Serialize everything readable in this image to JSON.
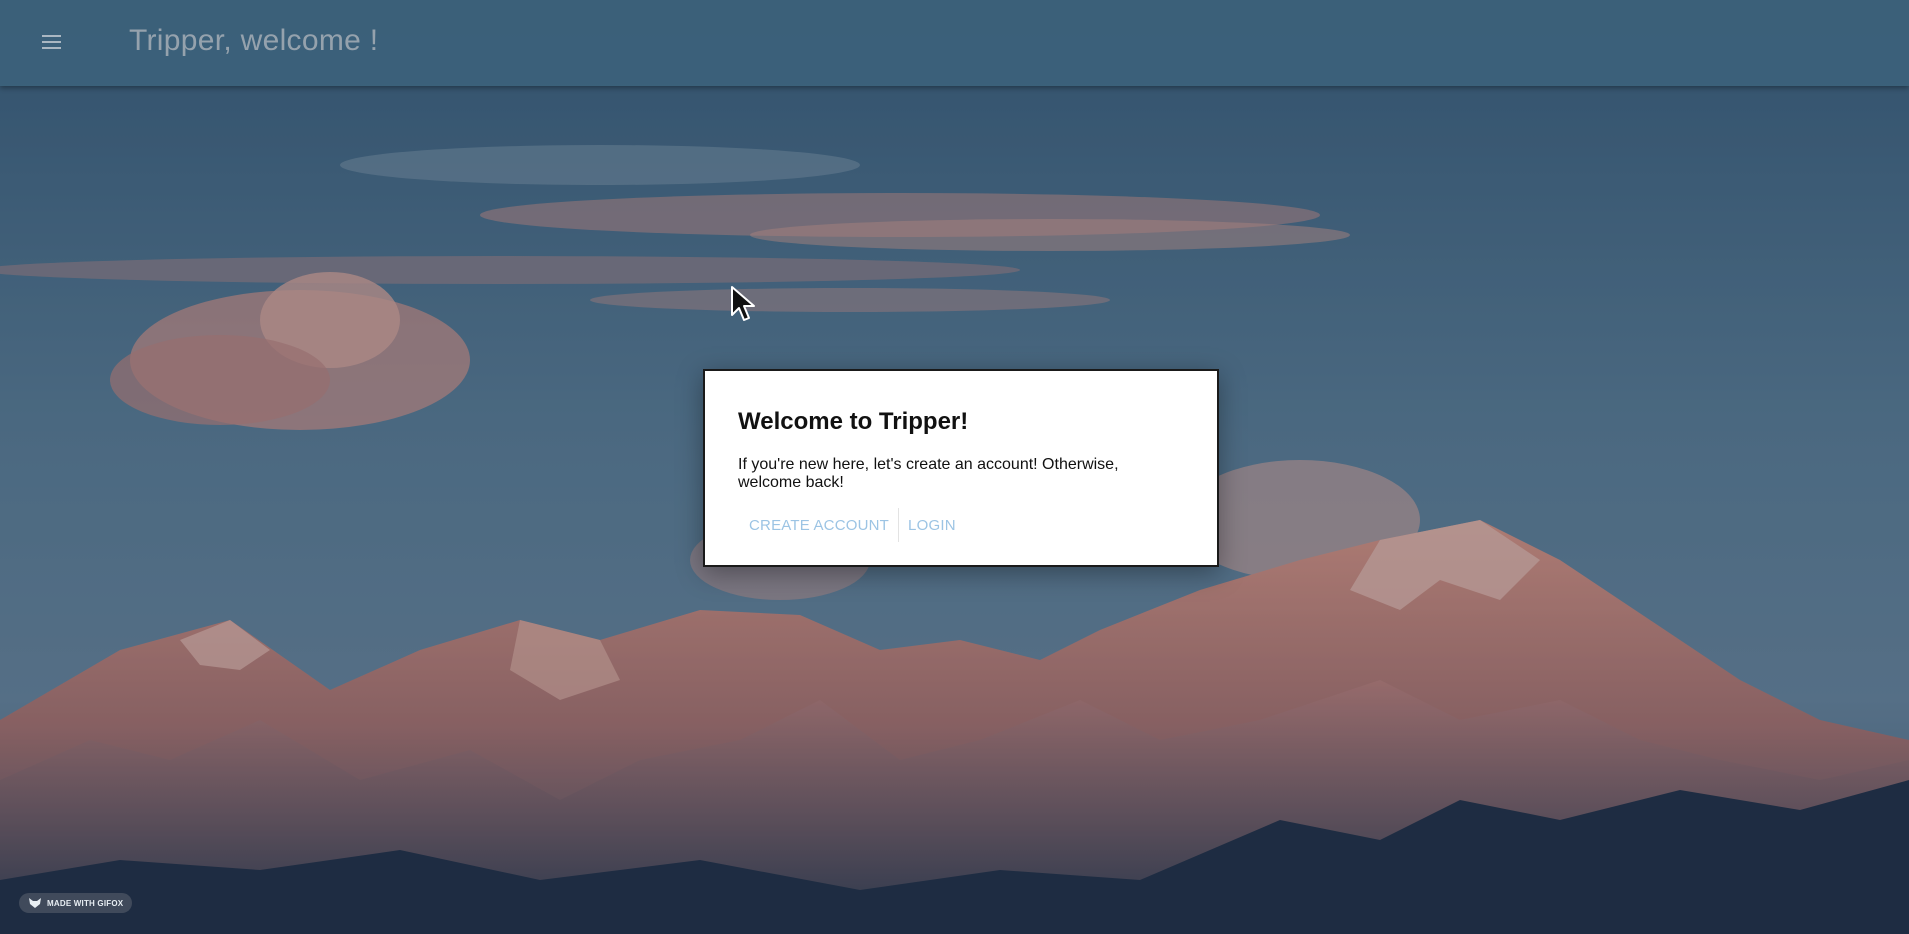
{
  "app": {
    "title": "Tripper, welcome !",
    "menu_icon": "hamburger-menu-icon"
  },
  "dialog": {
    "title": "Welcome to Tripper!",
    "body": "If you're new here, let's create an account! Otherwise, welcome back!",
    "create_account_label": "Create Account",
    "login_label": "Login",
    "accent_color": "#9cc4e4"
  },
  "badge": {
    "label": "MADE WITH GIFOX",
    "icon": "gifox-fox-icon"
  }
}
